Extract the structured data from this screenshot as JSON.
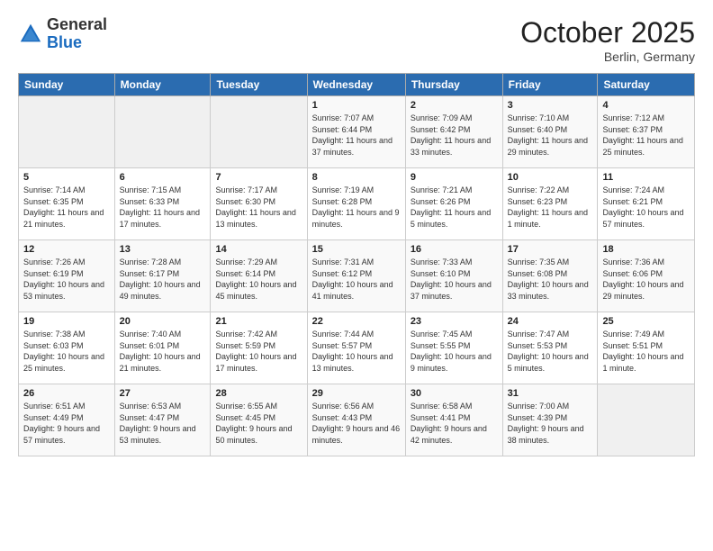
{
  "header": {
    "logo_general": "General",
    "logo_blue": "Blue",
    "month_title": "October 2025",
    "location": "Berlin, Germany"
  },
  "weekdays": [
    "Sunday",
    "Monday",
    "Tuesday",
    "Wednesday",
    "Thursday",
    "Friday",
    "Saturday"
  ],
  "weeks": [
    [
      {
        "day": "",
        "sunrise": "",
        "sunset": "",
        "daylight": ""
      },
      {
        "day": "",
        "sunrise": "",
        "sunset": "",
        "daylight": ""
      },
      {
        "day": "",
        "sunrise": "",
        "sunset": "",
        "daylight": ""
      },
      {
        "day": "1",
        "sunrise": "Sunrise: 7:07 AM",
        "sunset": "Sunset: 6:44 PM",
        "daylight": "Daylight: 11 hours and 37 minutes."
      },
      {
        "day": "2",
        "sunrise": "Sunrise: 7:09 AM",
        "sunset": "Sunset: 6:42 PM",
        "daylight": "Daylight: 11 hours and 33 minutes."
      },
      {
        "day": "3",
        "sunrise": "Sunrise: 7:10 AM",
        "sunset": "Sunset: 6:40 PM",
        "daylight": "Daylight: 11 hours and 29 minutes."
      },
      {
        "day": "4",
        "sunrise": "Sunrise: 7:12 AM",
        "sunset": "Sunset: 6:37 PM",
        "daylight": "Daylight: 11 hours and 25 minutes."
      }
    ],
    [
      {
        "day": "5",
        "sunrise": "Sunrise: 7:14 AM",
        "sunset": "Sunset: 6:35 PM",
        "daylight": "Daylight: 11 hours and 21 minutes."
      },
      {
        "day": "6",
        "sunrise": "Sunrise: 7:15 AM",
        "sunset": "Sunset: 6:33 PM",
        "daylight": "Daylight: 11 hours and 17 minutes."
      },
      {
        "day": "7",
        "sunrise": "Sunrise: 7:17 AM",
        "sunset": "Sunset: 6:30 PM",
        "daylight": "Daylight: 11 hours and 13 minutes."
      },
      {
        "day": "8",
        "sunrise": "Sunrise: 7:19 AM",
        "sunset": "Sunset: 6:28 PM",
        "daylight": "Daylight: 11 hours and 9 minutes."
      },
      {
        "day": "9",
        "sunrise": "Sunrise: 7:21 AM",
        "sunset": "Sunset: 6:26 PM",
        "daylight": "Daylight: 11 hours and 5 minutes."
      },
      {
        "day": "10",
        "sunrise": "Sunrise: 7:22 AM",
        "sunset": "Sunset: 6:23 PM",
        "daylight": "Daylight: 11 hours and 1 minute."
      },
      {
        "day": "11",
        "sunrise": "Sunrise: 7:24 AM",
        "sunset": "Sunset: 6:21 PM",
        "daylight": "Daylight: 10 hours and 57 minutes."
      }
    ],
    [
      {
        "day": "12",
        "sunrise": "Sunrise: 7:26 AM",
        "sunset": "Sunset: 6:19 PM",
        "daylight": "Daylight: 10 hours and 53 minutes."
      },
      {
        "day": "13",
        "sunrise": "Sunrise: 7:28 AM",
        "sunset": "Sunset: 6:17 PM",
        "daylight": "Daylight: 10 hours and 49 minutes."
      },
      {
        "day": "14",
        "sunrise": "Sunrise: 7:29 AM",
        "sunset": "Sunset: 6:14 PM",
        "daylight": "Daylight: 10 hours and 45 minutes."
      },
      {
        "day": "15",
        "sunrise": "Sunrise: 7:31 AM",
        "sunset": "Sunset: 6:12 PM",
        "daylight": "Daylight: 10 hours and 41 minutes."
      },
      {
        "day": "16",
        "sunrise": "Sunrise: 7:33 AM",
        "sunset": "Sunset: 6:10 PM",
        "daylight": "Daylight: 10 hours and 37 minutes."
      },
      {
        "day": "17",
        "sunrise": "Sunrise: 7:35 AM",
        "sunset": "Sunset: 6:08 PM",
        "daylight": "Daylight: 10 hours and 33 minutes."
      },
      {
        "day": "18",
        "sunrise": "Sunrise: 7:36 AM",
        "sunset": "Sunset: 6:06 PM",
        "daylight": "Daylight: 10 hours and 29 minutes."
      }
    ],
    [
      {
        "day": "19",
        "sunrise": "Sunrise: 7:38 AM",
        "sunset": "Sunset: 6:03 PM",
        "daylight": "Daylight: 10 hours and 25 minutes."
      },
      {
        "day": "20",
        "sunrise": "Sunrise: 7:40 AM",
        "sunset": "Sunset: 6:01 PM",
        "daylight": "Daylight: 10 hours and 21 minutes."
      },
      {
        "day": "21",
        "sunrise": "Sunrise: 7:42 AM",
        "sunset": "Sunset: 5:59 PM",
        "daylight": "Daylight: 10 hours and 17 minutes."
      },
      {
        "day": "22",
        "sunrise": "Sunrise: 7:44 AM",
        "sunset": "Sunset: 5:57 PM",
        "daylight": "Daylight: 10 hours and 13 minutes."
      },
      {
        "day": "23",
        "sunrise": "Sunrise: 7:45 AM",
        "sunset": "Sunset: 5:55 PM",
        "daylight": "Daylight: 10 hours and 9 minutes."
      },
      {
        "day": "24",
        "sunrise": "Sunrise: 7:47 AM",
        "sunset": "Sunset: 5:53 PM",
        "daylight": "Daylight: 10 hours and 5 minutes."
      },
      {
        "day": "25",
        "sunrise": "Sunrise: 7:49 AM",
        "sunset": "Sunset: 5:51 PM",
        "daylight": "Daylight: 10 hours and 1 minute."
      }
    ],
    [
      {
        "day": "26",
        "sunrise": "Sunrise: 6:51 AM",
        "sunset": "Sunset: 4:49 PM",
        "daylight": "Daylight: 9 hours and 57 minutes."
      },
      {
        "day": "27",
        "sunrise": "Sunrise: 6:53 AM",
        "sunset": "Sunset: 4:47 PM",
        "daylight": "Daylight: 9 hours and 53 minutes."
      },
      {
        "day": "28",
        "sunrise": "Sunrise: 6:55 AM",
        "sunset": "Sunset: 4:45 PM",
        "daylight": "Daylight: 9 hours and 50 minutes."
      },
      {
        "day": "29",
        "sunrise": "Sunrise: 6:56 AM",
        "sunset": "Sunset: 4:43 PM",
        "daylight": "Daylight: 9 hours and 46 minutes."
      },
      {
        "day": "30",
        "sunrise": "Sunrise: 6:58 AM",
        "sunset": "Sunset: 4:41 PM",
        "daylight": "Daylight: 9 hours and 42 minutes."
      },
      {
        "day": "31",
        "sunrise": "Sunrise: 7:00 AM",
        "sunset": "Sunset: 4:39 PM",
        "daylight": "Daylight: 9 hours and 38 minutes."
      },
      {
        "day": "",
        "sunrise": "",
        "sunset": "",
        "daylight": ""
      }
    ]
  ]
}
